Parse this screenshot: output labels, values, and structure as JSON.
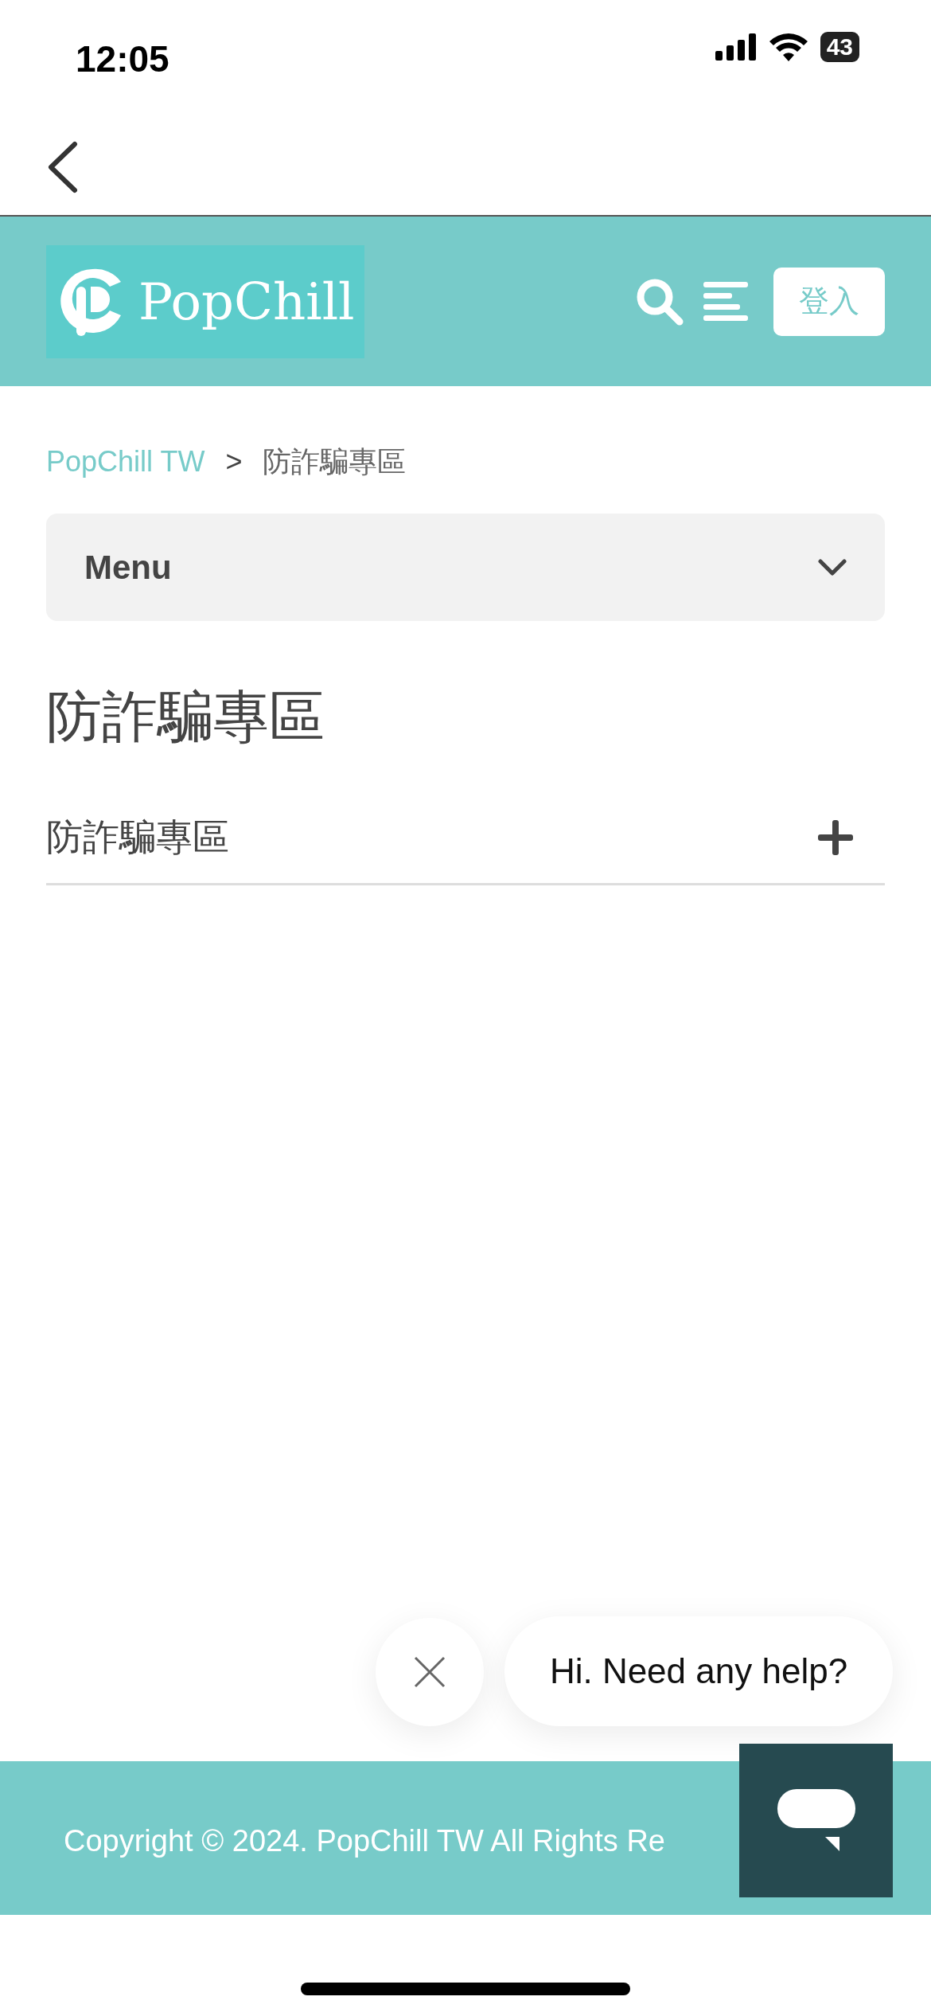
{
  "status_bar": {
    "time": "12:05",
    "battery": "43"
  },
  "header": {
    "logo": "PopChill",
    "login": "登入"
  },
  "breadcrumb": [
    {
      "label": "PopChill TW",
      "kind": "link"
    },
    {
      "label": ">",
      "kind": "separator"
    },
    {
      "label": "防詐騙專區",
      "kind": "current"
    }
  ],
  "menu": {
    "label": "Menu",
    "expanded": false
  },
  "title": "防詐騙專區",
  "accordion": [
    {
      "label": "防詐騙專區",
      "expanded": false
    }
  ],
  "chat": {
    "greeting": "Hi. Need any help?"
  },
  "footer": {
    "copyright": "Copyright © 2024. PopChill TW All Rights Re"
  }
}
